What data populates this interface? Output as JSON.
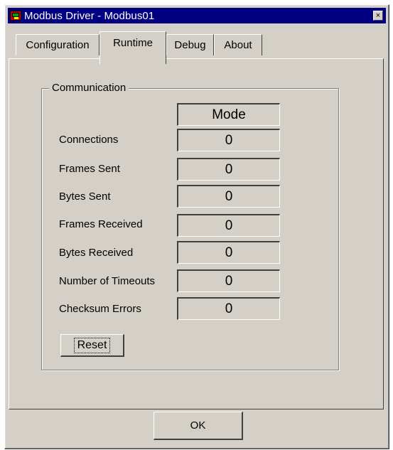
{
  "window": {
    "title": "Modbus Driver - Modbus01",
    "close_glyph": "×"
  },
  "tabs": [
    {
      "label": "Configuration",
      "active": false
    },
    {
      "label": "Runtime",
      "active": true
    },
    {
      "label": "Debug",
      "active": false
    },
    {
      "label": "About",
      "active": false
    }
  ],
  "communication": {
    "group_label": "Communication",
    "mode_label": "Mode",
    "stats": [
      {
        "label": "Connections",
        "value": "0"
      },
      {
        "label": "Frames Sent",
        "value": "0"
      },
      {
        "label": "Bytes Sent",
        "value": "0"
      },
      {
        "label": "Frames Received",
        "value": "0"
      },
      {
        "label": "Bytes Received",
        "value": "0"
      },
      {
        "label": "Number of Timeouts",
        "value": "0"
      },
      {
        "label": "Checksum Errors",
        "value": "0"
      }
    ],
    "reset_label": "Reset"
  },
  "footer": {
    "ok_label": "OK"
  },
  "icons": {
    "app": "modbus-app-icon",
    "close": "close-icon"
  },
  "colors": {
    "titlebar": "#000080",
    "face": "#d4d0c8"
  }
}
